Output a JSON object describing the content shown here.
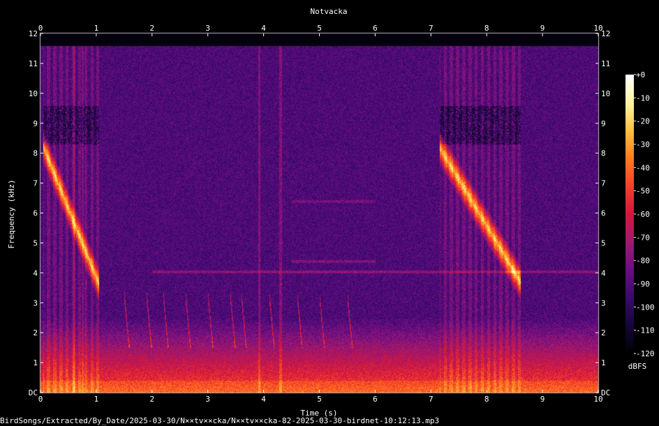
{
  "chart_data": {
    "type": "heatmap",
    "title": "Notvacka",
    "xlabel": "Time (s)",
    "ylabel": "Frequency (kHz)",
    "xlim": [
      0,
      10
    ],
    "ylim": [
      0,
      12
    ],
    "x_ticks": [
      "0",
      "1",
      "2",
      "3",
      "4",
      "5",
      "6",
      "7",
      "8",
      "9",
      "10"
    ],
    "y_ticks": [
      "DC",
      "1",
      "2",
      "3",
      "4",
      "5",
      "6",
      "7",
      "8",
      "9",
      "10",
      "11",
      "12"
    ],
    "colorbar": {
      "unit": "dBFS",
      "range": [
        -120,
        0
      ],
      "ticks": [
        "+0",
        "-10",
        "-20",
        "-30",
        "-40",
        "-50",
        "-60",
        "-70",
        "-80",
        "-90",
        "-100",
        "-110",
        "-120"
      ],
      "colormap": [
        "#000000",
        "#14063a",
        "#3a0a6e",
        "#6a0d85",
        "#a01a6e",
        "#d4143c",
        "#f4402a",
        "#ff7a1c",
        "#ffc040",
        "#fff5a0",
        "#ffffff"
      ]
    },
    "song_bouts": [
      {
        "start_s": 0.05,
        "end_s": 1.05,
        "freq_start_khz": 8.2,
        "freq_end_khz": 3.6
      },
      {
        "start_s": 7.15,
        "end_s": 8.6,
        "freq_start_khz": 8.2,
        "freq_end_khz": 3.7
      }
    ]
  },
  "footer": {
    "file_path": "BirdSongs/Extracted/By_Date/2025-03-30/N××tv××cka/N××tv××cka-82-2025-03-30-birdnet-10:12:13.mp3"
  }
}
